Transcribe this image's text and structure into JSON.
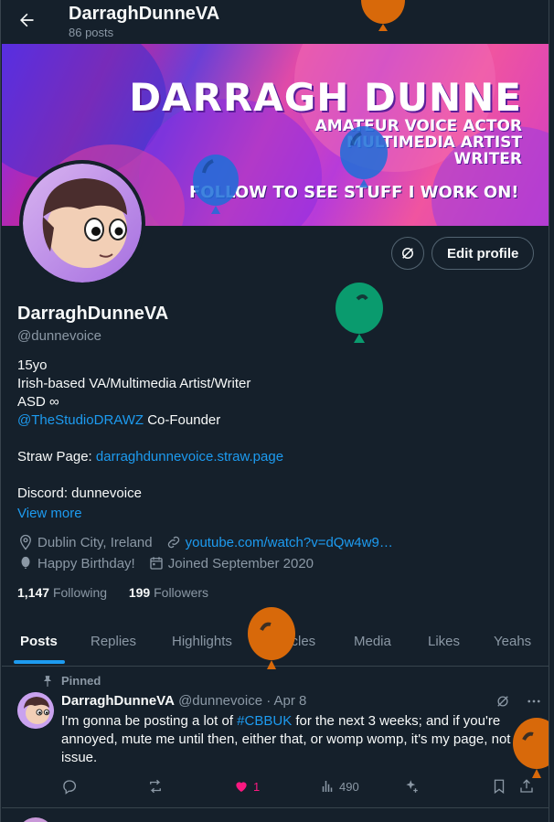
{
  "header": {
    "title": "DarraghDunneVA",
    "posts_count": "86 posts"
  },
  "banner": {
    "title": "DARRAGH DUNNE",
    "lines": [
      "AMATEUR VOICE ACTOR",
      "MULTIMEDIA ARTIST",
      "WRITER"
    ],
    "follow": "FOLLOW TO SEE STUFF I WORK ON!"
  },
  "actions": {
    "edit_profile": "Edit profile"
  },
  "profile": {
    "name": "DarraghDunneVA",
    "handle": "@dunnevoice",
    "bio": {
      "line1": "15yo",
      "line2": "Irish-based VA/Multimedia Artist/Writer",
      "line3": "ASD ∞",
      "studio_link": "@TheStudioDRAWZ",
      "studio_text": " Co-Founder",
      "straw_label": "Straw Page: ",
      "straw_link": "darraghdunnevoice.straw.page",
      "discord": "Discord: dunnevoice"
    },
    "view_more": "View more",
    "location": "Dublin City, Ireland",
    "website": "youtube.com/watch?v=dQw4w9…",
    "birthday": "Happy Birthday!",
    "joined": "Joined September 2020",
    "following_count": "1,147",
    "following_label": "Following",
    "followers_count": "199",
    "followers_label": "Followers"
  },
  "tabs": [
    "Posts",
    "Replies",
    "Highlights",
    "Articles",
    "Media",
    "Likes",
    "Yeahs"
  ],
  "tweet": {
    "pinned_label": "Pinned",
    "author": "DarraghDunneVA",
    "handle_date": "@dunnevoice · Apr 8",
    "text_before": "I'm gonna be posting a lot of ",
    "hashtag": "#CBBUK",
    "text_after": " for the next 3 weeks; and if you're annoyed, mute me until then, either that, or womp womp, it's my page, not my issue.",
    "likes": "1",
    "views": "490"
  },
  "colors": {
    "background": "#15202b",
    "accent": "#1d9bf0",
    "like": "#f91880",
    "muted": "#8b98a5"
  }
}
